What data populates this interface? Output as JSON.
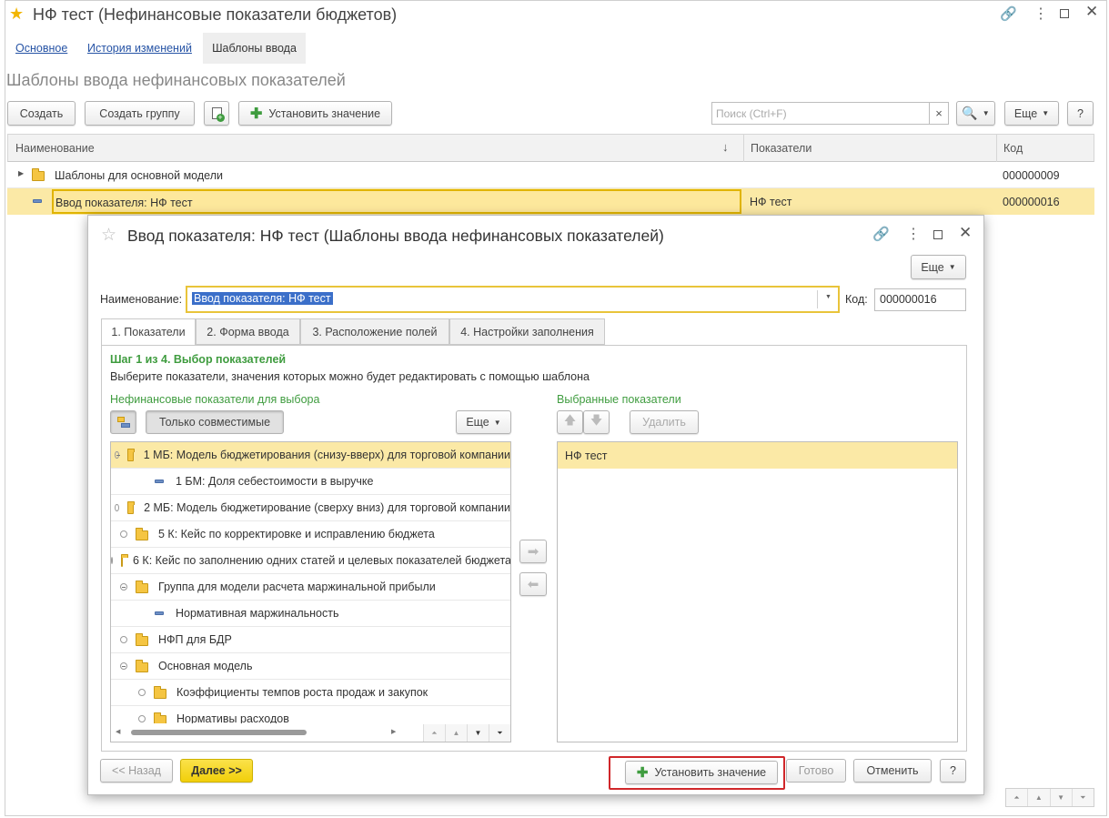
{
  "window": {
    "title": "НФ тест (Нефинансовые показатели бюджетов)"
  },
  "nav_tabs": [
    "Основное",
    "История изменений",
    "Шаблоны ввода"
  ],
  "page_title": "Шаблоны ввода нефинансовых показателей",
  "toolbar": {
    "create": "Создать",
    "create_group": "Создать группу",
    "set_value": "Установить значение",
    "search_placeholder": "Поиск (Ctrl+F)",
    "search_clear": "×",
    "more": "Еще",
    "help": "?"
  },
  "list": {
    "columns": [
      "Наименование",
      "Показатели",
      "Код"
    ],
    "sort_arrow": "↓",
    "rows": [
      {
        "name": "Шаблоны для основной модели",
        "indicators": "",
        "code": "000000009"
      },
      {
        "name": "Ввод показателя: НФ тест",
        "indicators": "НФ тест",
        "code": "000000016"
      }
    ]
  },
  "dialog": {
    "title": "Ввод показателя: НФ тест (Шаблоны ввода нефинансовых показателей)",
    "more": "Еще",
    "name_label": "Наименование:",
    "name_value": "Ввод показателя: НФ тест",
    "code_label": "Код:",
    "code_value": "000000016",
    "tabs": [
      "1. Показатели",
      "2. Форма ввода",
      "3. Расположение полей",
      "4. Настройки заполнения"
    ],
    "step_title": "Шаг 1 из 4. Выбор показателей",
    "step_desc": "Выберите показатели, значения которых можно будет редактировать с помощью шаблона",
    "left_header": "Нефинансовые показатели для выбора",
    "right_header": "Выбранные показатели",
    "only_compatible": "Только совместимые",
    "more_left": "Еще",
    "delete": "Удалить",
    "tree": [
      {
        "label": "1 МБ: Модель бюджетирования (снизу-вверх) для торговой компании",
        "type": "folder",
        "expanded": true
      },
      {
        "label": "1 БМ: Доля себестоимости в выручке",
        "type": "item"
      },
      {
        "label": "2 МБ: Модель бюджетирование (сверху вниз) для торговой компании",
        "type": "folder",
        "expanded": false
      },
      {
        "label": "5 К: Кейс по корректировке и исправлению бюджета",
        "type": "folder",
        "expanded": false
      },
      {
        "label": "6 К: Кейс по заполнению одних статей и целевых показателей бюджета",
        "type": "folder",
        "expanded": false
      },
      {
        "label": "Группа для модели расчета маржинальной прибыли",
        "type": "folder",
        "expanded": true
      },
      {
        "label": "Нормативная маржинальность",
        "type": "item"
      },
      {
        "label": "НФП для БДР",
        "type": "folder",
        "expanded": false
      },
      {
        "label": "Основная модель",
        "type": "folder",
        "expanded": true
      },
      {
        "label": "Коэффициенты темпов роста продаж и закупок",
        "type": "subfolder",
        "expanded": false
      },
      {
        "label": "Нормативы расходов",
        "type": "subfolder",
        "expanded": false
      }
    ],
    "selected": [
      "НФ тест"
    ],
    "footer": {
      "back": "<< Назад",
      "next": "Далее >>",
      "set_value": "Установить значение",
      "done": "Готово",
      "cancel": "Отменить",
      "help": "?"
    }
  },
  "colors": {
    "accent_yellow": "#fbe9a6",
    "highlight_border": "#e0b400",
    "green": "#3f9c3f",
    "next_button": "#f6d40f",
    "red_frame": "#d0272a"
  }
}
